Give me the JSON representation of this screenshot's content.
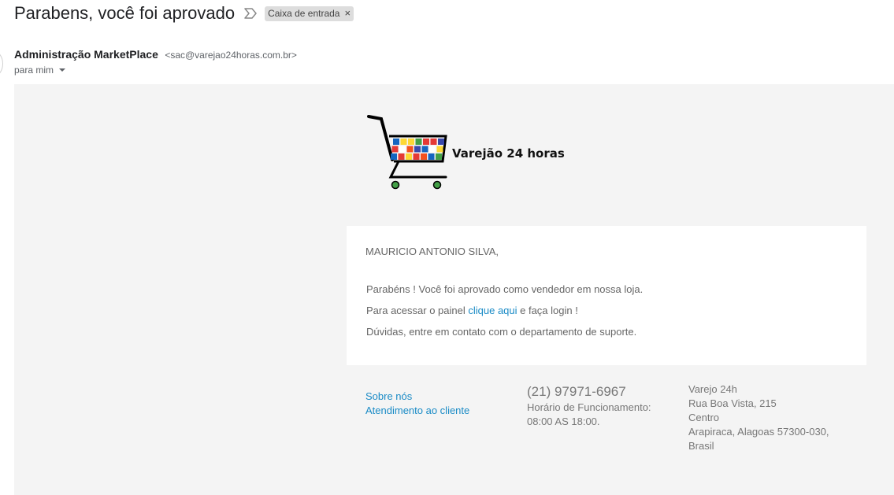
{
  "header": {
    "subject": "Parabens, você foi aprovado",
    "label": "Caixa de entrada",
    "label_remove": "×"
  },
  "sender": {
    "name": "Administração MarketPlace",
    "email": "<sac@varejao24horas.com.br>",
    "to": "para mim"
  },
  "logo": {
    "text": "Varejão 24 horas",
    "colors": [
      "#1565c0",
      "#fdd835",
      "#e53935",
      "#43a047",
      "#f4511e",
      "#3949ab",
      "#ffffff"
    ]
  },
  "message": {
    "greeting": "MAURICIO ANTONIO SILVA,",
    "line1": "Parabéns ! Você foi aprovado como vendedor em nossa loja.",
    "line2_before": "Para acessar o painel ",
    "line2_link": "clique aqui",
    "line2_after": " e faça login !",
    "line3": "Dúvidas, entre em contato com o departamento de suporte."
  },
  "footer": {
    "links": [
      "Sobre nós",
      "Atendimento ao cliente"
    ],
    "phone": "(21) 97971-6967",
    "hours_label": "Horário de Funcionamento:",
    "hours": "08:00 AS 18:00.",
    "address": [
      "Varejo 24h",
      "Rua Boa Vista, 215",
      "Centro",
      "Arapiraca, Alagoas 57300-030,",
      "Brasil"
    ]
  },
  "colors": {
    "link": "#1a8bc6",
    "body_bg": "#f4f4f4",
    "card_bg": "#ffffff",
    "chip_bg": "#dddddd"
  }
}
